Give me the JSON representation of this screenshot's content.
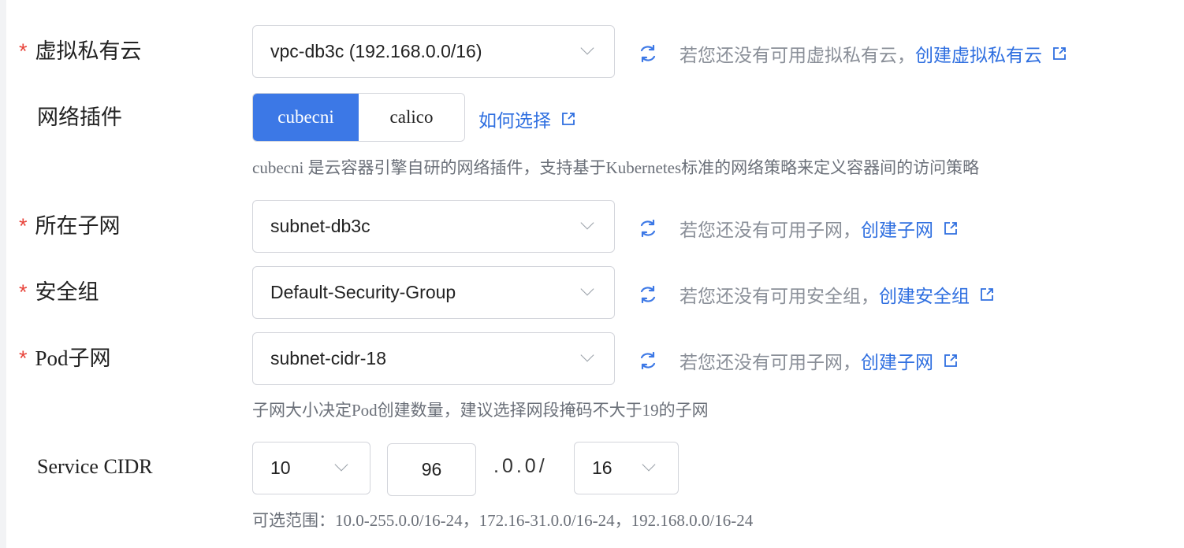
{
  "vpc": {
    "required_mark": "*",
    "label": "虚拟私有云",
    "value": "vpc-db3c (192.168.0.0/16)",
    "hint": "若您还没有可用虚拟私有云，",
    "link": "创建虚拟私有云"
  },
  "network_plugin": {
    "label": "网络插件",
    "options": [
      "cubecni",
      "calico"
    ],
    "selected": "cubecni",
    "link": "如何选择",
    "note": "cubecni 是云容器引擎自研的网络插件，支持基于Kubernetes标准的网络策略来定义容器间的访问策略"
  },
  "subnet": {
    "required_mark": "*",
    "label": "所在子网",
    "value": "subnet-db3c",
    "hint": "若您还没有可用子网，",
    "link": "创建子网"
  },
  "security_group": {
    "required_mark": "*",
    "label": "安全组",
    "value": "Default-Security-Group",
    "hint": "若您还没有可用安全组，",
    "link": "创建安全组"
  },
  "pod_subnet": {
    "required_mark": "*",
    "label": "Pod子网",
    "value": "subnet-cidr-18",
    "hint": "若您还没有可用子网，",
    "link": "创建子网",
    "note": "子网大小决定Pod创建数量，建议选择网段掩码不大于19的子网"
  },
  "service_cidr": {
    "label": "Service CIDR",
    "octet1": "10",
    "octet2": "96",
    "fixed": ".0.0/",
    "mask": "16",
    "note": "可选范围：10.0-255.0.0/16-24，172.16-31.0.0/16-24，192.168.0.0/16-24"
  },
  "colors": {
    "accent": "#3c78e6",
    "link": "#2f6fe0",
    "required": "#e8453c",
    "border": "#d3d5db"
  },
  "icons": [
    "refresh-icon",
    "external-link-icon",
    "chevron-down-icon"
  ]
}
